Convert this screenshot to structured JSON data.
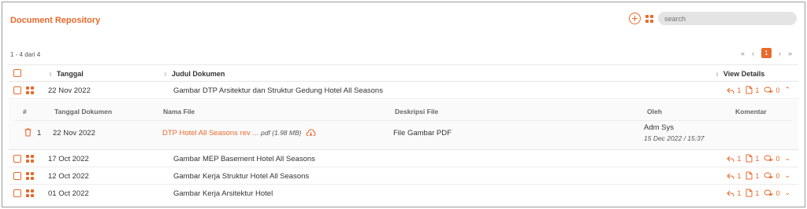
{
  "header": {
    "title": "Document Repository",
    "search_placeholder": "search"
  },
  "list": {
    "count_text": "1 - 4 dari 4"
  },
  "pager": {
    "first": "«",
    "prev": "‹",
    "current": "1",
    "next": "›",
    "last": "»"
  },
  "columns": {
    "date": "Tanggal",
    "title": "Judul Dokumen",
    "details": "View Details"
  },
  "rows": [
    {
      "date": "22 Nov 2022",
      "title": "Gambar DTP Arsitektur dan Struktur Gedung Hotel All Seasons",
      "replies": "1",
      "files": "1",
      "comments": "0",
      "expanded": true
    },
    {
      "date": "17 Oct 2022",
      "title": "Gambar MEP Basement Hotel All Seasons",
      "replies": "1",
      "files": "1",
      "comments": "0"
    },
    {
      "date": "12 Oct 2022",
      "title": "Gambar Kerja Struktur Hotel All Seasons",
      "replies": "1",
      "files": "1",
      "comments": "0"
    },
    {
      "date": "01 Oct 2022",
      "title": "Gambar Kerja Arsitektur Hotel",
      "replies": "1",
      "files": "1",
      "comments": "0"
    }
  ],
  "subtable": {
    "headers": {
      "num": "#",
      "date": "Tanggal Dokumen",
      "file": "Nama File",
      "desc": "Deskripsi File",
      "by": "Oleh",
      "comment": "Komentar"
    },
    "row": {
      "num": "1",
      "date": "22 Nov 2022",
      "file_name": "DTP Hotel All Seasons rev ...",
      "file_ext": "pdf (1.98 MB)",
      "desc": "File Gambar PDF",
      "by": "Adm Sys",
      "timestamp": "15 Dec 2022 / 15:37"
    }
  },
  "colors": {
    "accent": "#e8692c"
  }
}
